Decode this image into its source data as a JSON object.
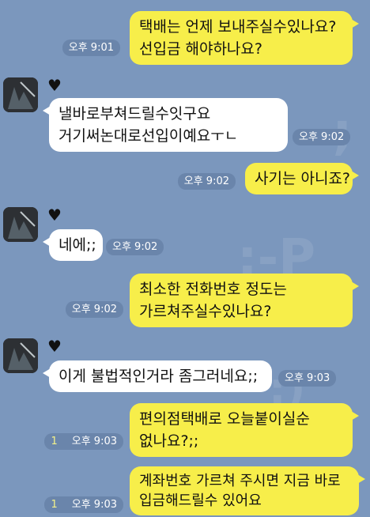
{
  "messages": [
    {
      "id": "m1",
      "side": "mine",
      "lines": [
        "택배는 언제 보내주실수있나요?",
        "선입금 해야하나요?"
      ],
      "time": "오후 9:01",
      "unread": ""
    },
    {
      "id": "m2",
      "side": "theirs",
      "lines": [
        "낼바로부쳐드릴수잇구요",
        "거기써논대로선입이예요ㅜㄴ"
      ],
      "time": "오후 9:02",
      "unread": ""
    },
    {
      "id": "m3",
      "side": "mine",
      "lines": [
        "사기는 아니죠?"
      ],
      "time": "오후 9:02",
      "unread": ""
    },
    {
      "id": "m4",
      "side": "theirs",
      "lines": [
        "네에;;"
      ],
      "time": "오후 9:02",
      "unread": ""
    },
    {
      "id": "m5",
      "side": "mine",
      "lines": [
        "최소한 전화번호 정도는",
        "가르쳐주실수있나요?"
      ],
      "time": "오후 9:02",
      "unread": ""
    },
    {
      "id": "m6",
      "side": "theirs",
      "lines": [
        "이게 불법적인거라 좀그러네요;;"
      ],
      "time": "오후 9:03",
      "unread": ""
    },
    {
      "id": "m7",
      "side": "mine",
      "lines": [
        "편의점택배로  오늘붙이실순",
        "없나요?;;"
      ],
      "time": "오후 9:03",
      "unread": "1"
    },
    {
      "id": "m8",
      "side": "mine",
      "lines": [
        "계좌번호 가르쳐 주시면 지금 바로",
        "입금해드릴수 있어요"
      ],
      "time": "오후 9:03",
      "unread": "1"
    }
  ],
  "contact": {
    "heart": "♥",
    "avatar_icon": "profile-photo"
  },
  "colors": {
    "background": "#7b97bd",
    "mine_bubble": "#f7ee4a",
    "theirs_bubble": "#ffffff",
    "stamp": "#6a85ab"
  }
}
